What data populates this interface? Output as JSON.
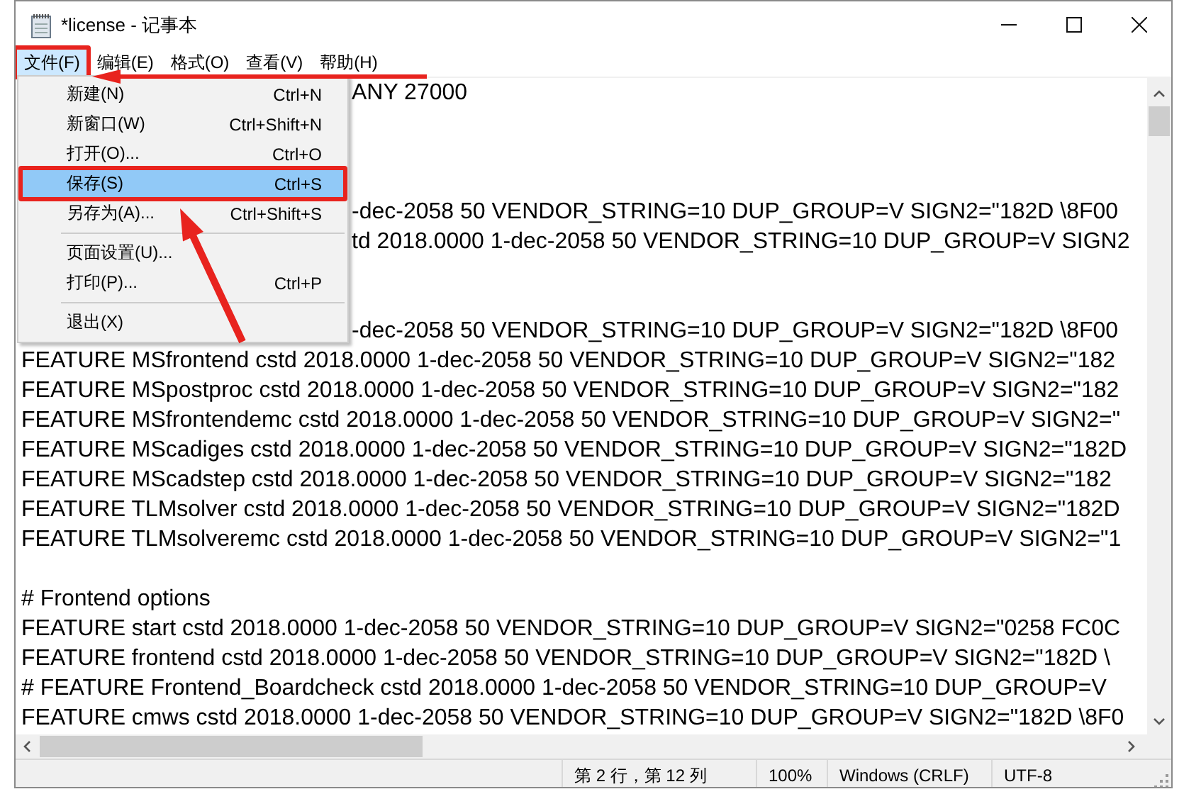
{
  "window": {
    "title": "*license - 记事本"
  },
  "menus": [
    {
      "label": "文件(F)",
      "selected": true,
      "marked": true
    },
    {
      "label": "编辑(E)",
      "selected": false,
      "marked": false
    },
    {
      "label": "格式(O)",
      "selected": false,
      "marked": false
    },
    {
      "label": "查看(V)",
      "selected": false,
      "marked": false
    },
    {
      "label": "帮助(H)",
      "selected": false,
      "marked": false
    }
  ],
  "file_menu": {
    "items": [
      {
        "kind": "item",
        "label": "新建(N)",
        "shortcut": "Ctrl+N",
        "selected": false,
        "marked": false
      },
      {
        "kind": "item",
        "label": "新窗口(W)",
        "shortcut": "Ctrl+Shift+N",
        "selected": false,
        "marked": false
      },
      {
        "kind": "item",
        "label": "打开(O)...",
        "shortcut": "Ctrl+O",
        "selected": false,
        "marked": false
      },
      {
        "kind": "item",
        "label": "保存(S)",
        "shortcut": "Ctrl+S",
        "selected": true,
        "marked": true
      },
      {
        "kind": "item",
        "label": "另存为(A)...",
        "shortcut": "Ctrl+Shift+S",
        "selected": false,
        "marked": false
      },
      {
        "kind": "separator"
      },
      {
        "kind": "item",
        "label": "页面设置(U)...",
        "selected": false,
        "marked": false
      },
      {
        "kind": "item",
        "label": "打印(P)...",
        "shortcut": "Ctrl+P",
        "selected": false,
        "marked": false
      },
      {
        "kind": "separator"
      },
      {
        "kind": "item",
        "label": "退出(X)",
        "selected": false,
        "marked": false
      }
    ]
  },
  "editor": {
    "lines": [
      {
        "kind": "partial",
        "text": "ANY 27000"
      },
      {
        "kind": "covered"
      },
      {
        "kind": "covered"
      },
      {
        "kind": "covered"
      },
      {
        "kind": "partial",
        "text": "-dec-2058 50 VENDOR_STRING=10 DUP_GROUP=V SIGN2=\"182D \\8F00"
      },
      {
        "kind": "partial",
        "text": "td 2018.0000 1-dec-2058 50 VENDOR_STRING=10 DUP_GROUP=V SIGN2"
      },
      {
        "kind": "covered"
      },
      {
        "kind": "covered"
      },
      {
        "kind": "partial",
        "text": "-dec-2058 50 VENDOR_STRING=10 DUP_GROUP=V SIGN2=\"182D \\8F00"
      },
      {
        "kind": "full",
        "text": "FEATURE MSfrontend cstd 2018.0000 1-dec-2058 50 VENDOR_STRING=10 DUP_GROUP=V SIGN2=\"182"
      },
      {
        "kind": "full",
        "text": "FEATURE MSpostproc cstd 2018.0000 1-dec-2058 50 VENDOR_STRING=10 DUP_GROUP=V SIGN2=\"182"
      },
      {
        "kind": "full",
        "text": "FEATURE MSfrontendemc cstd 2018.0000 1-dec-2058 50 VENDOR_STRING=10 DUP_GROUP=V SIGN2=\""
      },
      {
        "kind": "full",
        "text": "FEATURE MScadiges cstd 2018.0000 1-dec-2058 50 VENDOR_STRING=10 DUP_GROUP=V SIGN2=\"182D"
      },
      {
        "kind": "full",
        "text": "FEATURE MScadstep cstd 2018.0000 1-dec-2058 50 VENDOR_STRING=10 DUP_GROUP=V SIGN2=\"182"
      },
      {
        "kind": "full",
        "text": "FEATURE TLMsolver cstd 2018.0000 1-dec-2058 50 VENDOR_STRING=10 DUP_GROUP=V SIGN2=\"182D"
      },
      {
        "kind": "full",
        "text": "FEATURE TLMsolveremc cstd 2018.0000 1-dec-2058 50 VENDOR_STRING=10 DUP_GROUP=V SIGN2=\"1"
      },
      {
        "kind": "blank"
      },
      {
        "kind": "full",
        "text": "# Frontend options"
      },
      {
        "kind": "full",
        "text": "FEATURE start cstd 2018.0000 1-dec-2058 50 VENDOR_STRING=10 DUP_GROUP=V SIGN2=\"0258 FC0C"
      },
      {
        "kind": "full",
        "text": "FEATURE frontend cstd 2018.0000 1-dec-2058 50 VENDOR_STRING=10 DUP_GROUP=V SIGN2=\"182D \\"
      },
      {
        "kind": "full",
        "text": "# FEATURE Frontend_Boardcheck cstd 2018.0000 1-dec-2058 50 VENDOR_STRING=10 DUP_GROUP=V"
      },
      {
        "kind": "full",
        "text": "FEATURE cmws cstd 2018.0000 1-dec-2058 50 VENDOR_STRING=10 DUP_GROUP=V SIGN2=\"182D \\8F0"
      }
    ]
  },
  "status_bar": {
    "position": "第 2 行，第 12 列",
    "zoom": "100%",
    "line_ending": "Windows (CRLF)",
    "encoding": "UTF-8"
  }
}
